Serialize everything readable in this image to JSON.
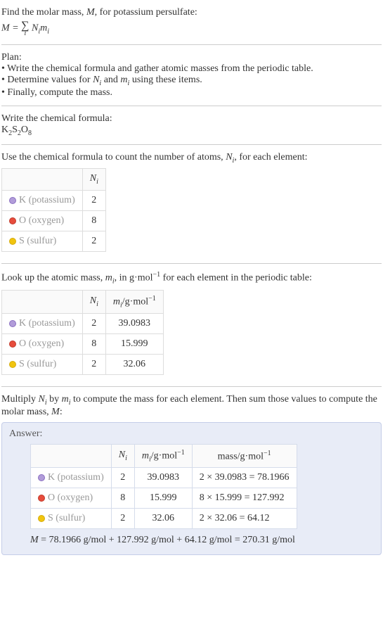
{
  "intro": {
    "line1_pre": "Find the molar mass, ",
    "line1_var": "M",
    "line1_post": ", for potassium persulfate:",
    "formula_lhs": "M",
    "formula_eq": " = ",
    "formula_sigma": "∑",
    "formula_index": "i",
    "formula_rhs_n": "N",
    "formula_rhs_n_sub": "i",
    "formula_rhs_m": "m",
    "formula_rhs_m_sub": "i"
  },
  "plan": {
    "title": "Plan:",
    "b1_pre": "• Write the chemical formula and gather atomic masses from the periodic table.",
    "b2_pre": "• Determine values for ",
    "b2_n": "N",
    "b2_n_sub": "i",
    "b2_and": " and ",
    "b2_m": "m",
    "b2_m_sub": "i",
    "b2_post": " using these items.",
    "b3": "• Finally, compute the mass."
  },
  "chem": {
    "title": "Write the chemical formula:",
    "k": "K",
    "k_sub": "2",
    "s": "S",
    "s_sub": "2",
    "o": "O",
    "o_sub": "8"
  },
  "count": {
    "title_pre": "Use the chemical formula to count the number of atoms, ",
    "title_n": "N",
    "title_n_sub": "i",
    "title_post": ", for each element:",
    "header_n": "N",
    "header_n_sub": "i",
    "rows": [
      {
        "sym": "K",
        "name": " (potassium)",
        "n": "2",
        "dot": "dot-k"
      },
      {
        "sym": "O",
        "name": " (oxygen)",
        "n": "8",
        "dot": "dot-o"
      },
      {
        "sym": "S",
        "name": " (sulfur)",
        "n": "2",
        "dot": "dot-s"
      }
    ]
  },
  "mass": {
    "title_pre": "Look up the atomic mass, ",
    "title_m": "m",
    "title_m_sub": "i",
    "title_mid": ", in g·mol",
    "title_sup": "−1",
    "title_post": " for each element in the periodic table:",
    "header_n": "N",
    "header_n_sub": "i",
    "header_m": "m",
    "header_m_sub": "i",
    "header_m_unit": "/g·mol",
    "header_m_sup": "−1",
    "rows": [
      {
        "sym": "K",
        "name": " (potassium)",
        "n": "2",
        "m": "39.0983",
        "dot": "dot-k"
      },
      {
        "sym": "O",
        "name": " (oxygen)",
        "n": "8",
        "m": "15.999",
        "dot": "dot-o"
      },
      {
        "sym": "S",
        "name": " (sulfur)",
        "n": "2",
        "m": "32.06",
        "dot": "dot-s"
      }
    ]
  },
  "compute": {
    "title_pre": "Multiply ",
    "title_n": "N",
    "title_n_sub": "i",
    "title_by": " by ",
    "title_m": "m",
    "title_m_sub": "i",
    "title_mid": " to compute the mass for each element. Then sum those values to compute the molar mass, ",
    "title_mvar": "M",
    "title_post": ":"
  },
  "answer": {
    "label": "Answer:",
    "header_n": "N",
    "header_n_sub": "i",
    "header_m": "m",
    "header_m_sub": "i",
    "header_m_unit": "/g·mol",
    "header_m_sup": "−1",
    "header_mass": "mass/g·mol",
    "header_mass_sup": "−1",
    "rows": [
      {
        "sym": "K",
        "name": " (potassium)",
        "n": "2",
        "m": "39.0983",
        "calc": "2 × 39.0983 = 78.1966",
        "dot": "dot-k"
      },
      {
        "sym": "O",
        "name": " (oxygen)",
        "n": "8",
        "m": "15.999",
        "calc": "8 × 15.999 = 127.992",
        "dot": "dot-o"
      },
      {
        "sym": "S",
        "name": " (sulfur)",
        "n": "2",
        "m": "32.06",
        "calc": "2 × 32.06 = 64.12",
        "dot": "dot-s"
      }
    ],
    "final_lhs": "M",
    "final_eq": " = 78.1966 g/mol + 127.992 g/mol + 64.12 g/mol = 270.31 g/mol"
  }
}
